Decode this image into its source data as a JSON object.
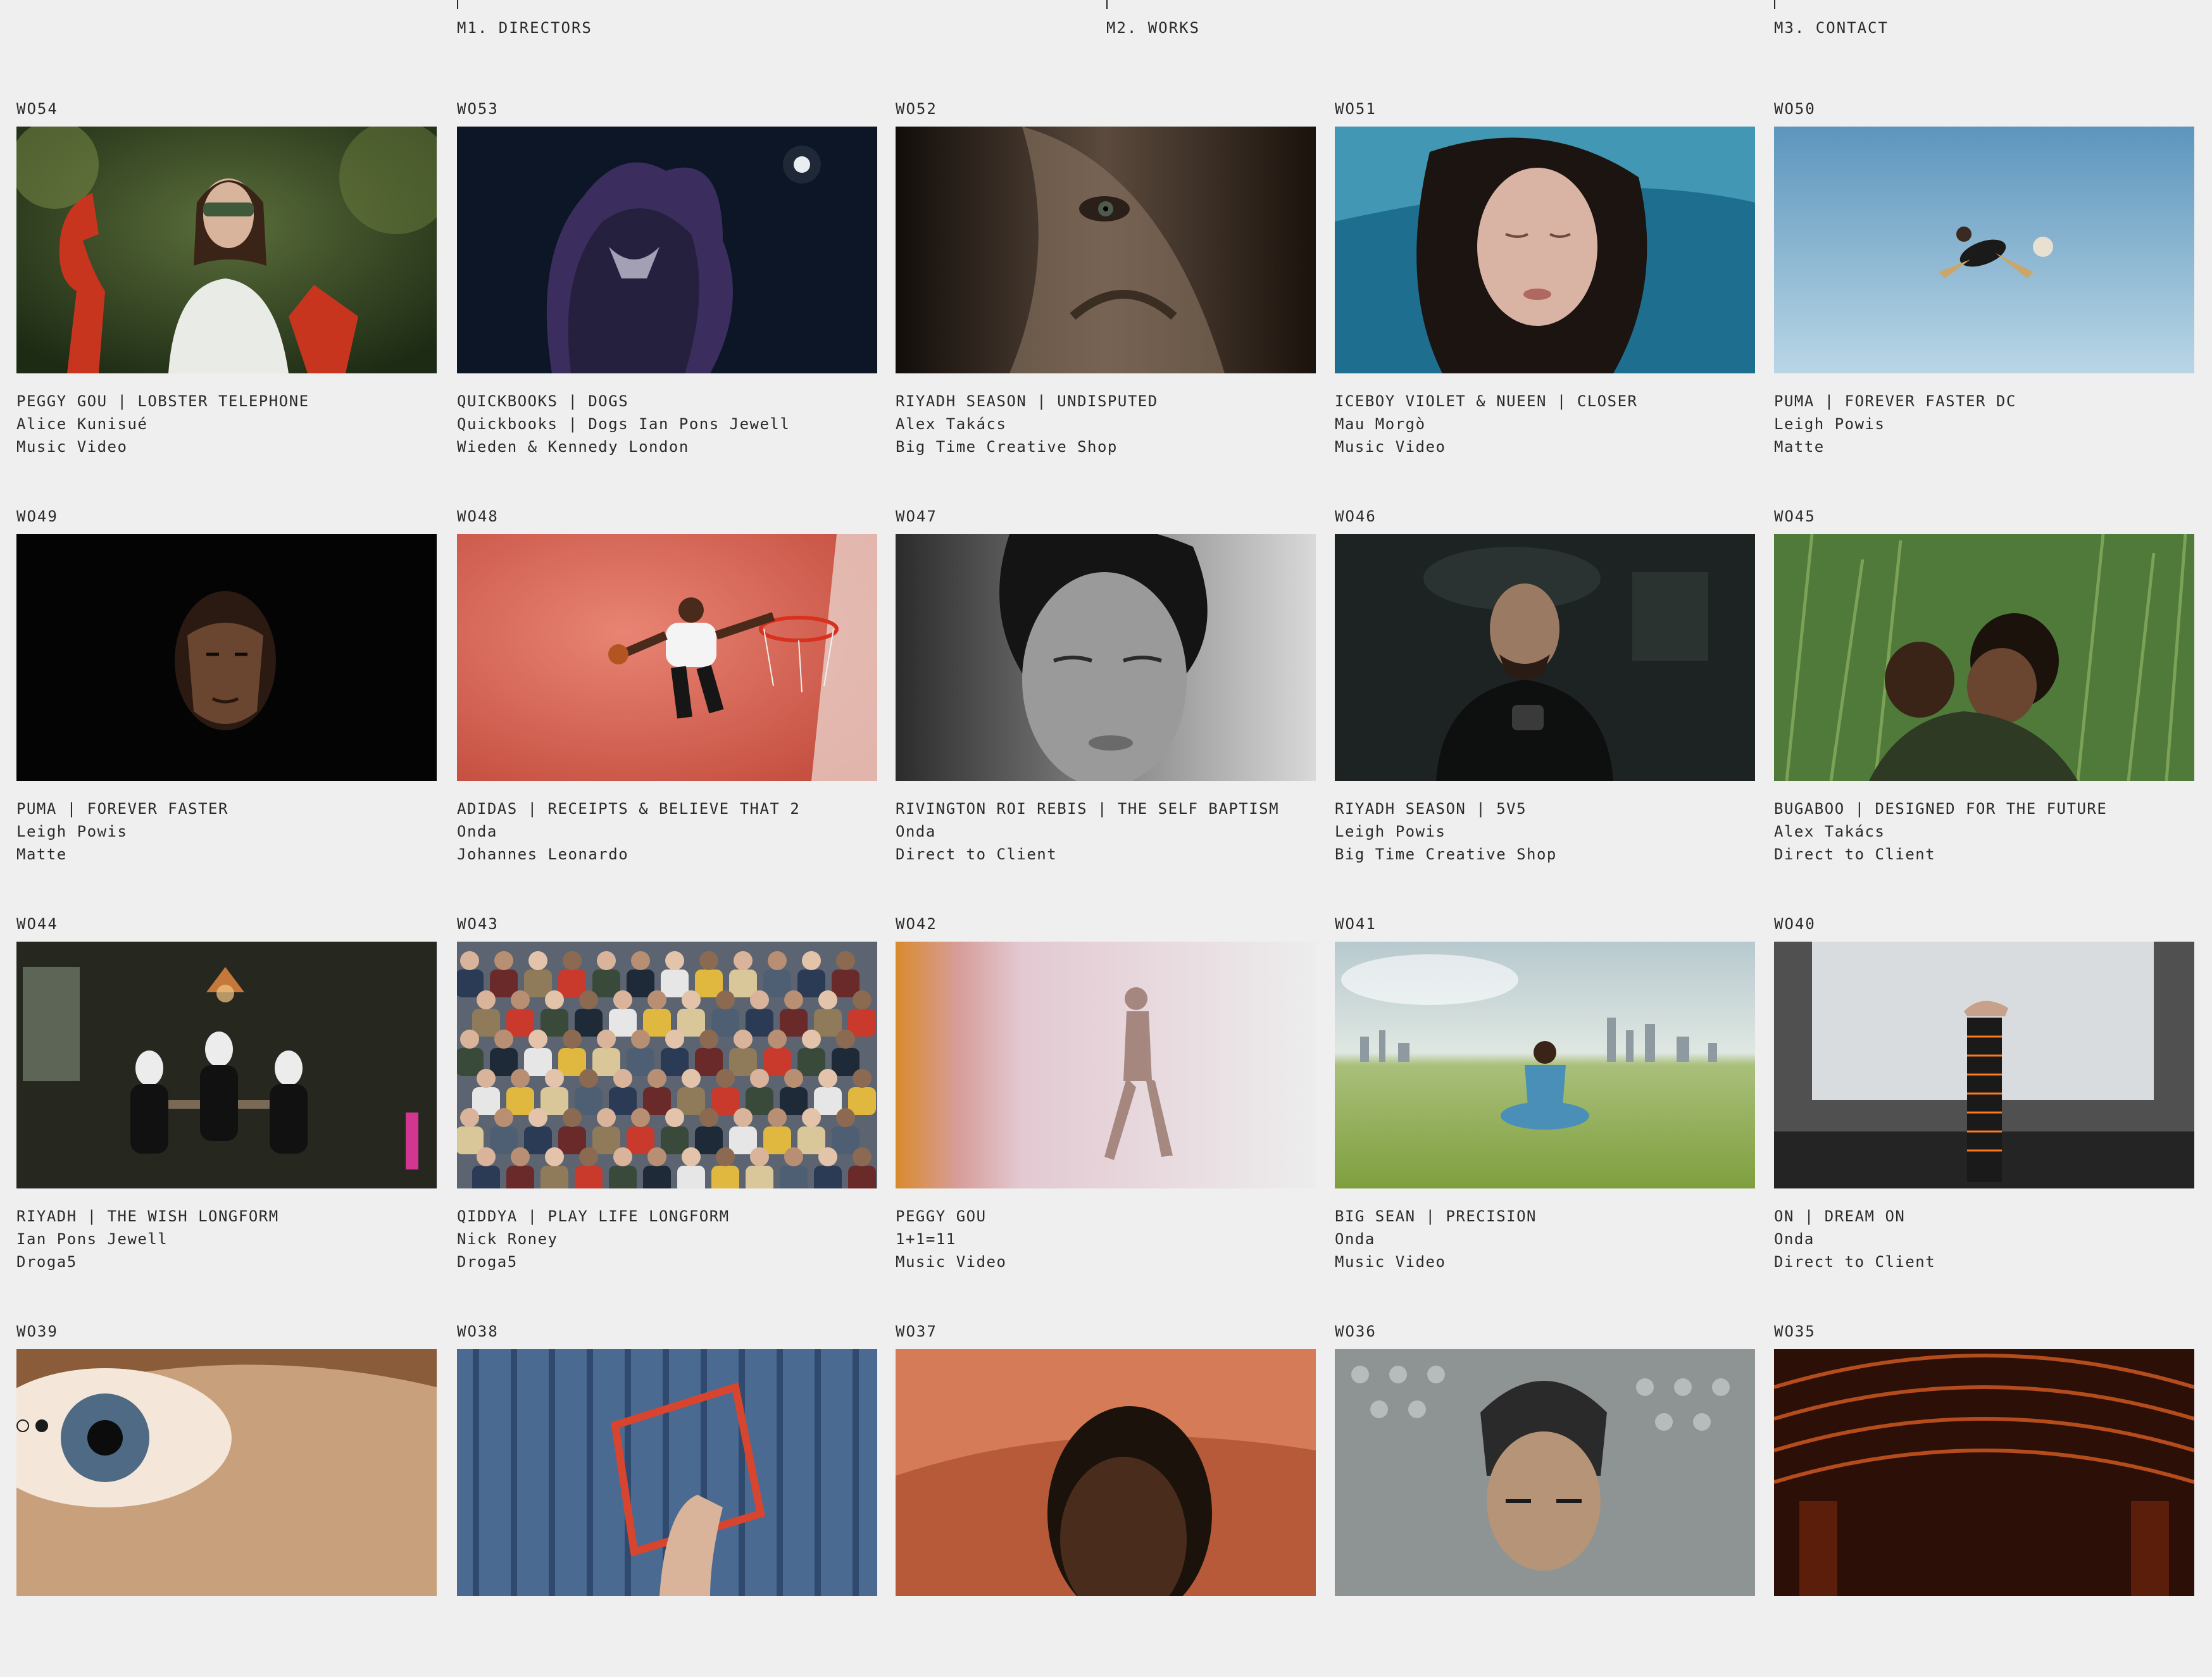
{
  "nav": [
    {
      "label": "M1. DIRECTORS"
    },
    {
      "label": "M2. WORKS"
    },
    {
      "label": "M3. CONTACT"
    }
  ],
  "works": [
    {
      "code": "WO54",
      "title": "PEGGY GOU | LOBSTER TELEPHONE",
      "director": "Alice Kunisué",
      "client": "Music Video",
      "scene": "woman-red-claw"
    },
    {
      "code": "WO53",
      "title": "QUICKBOOKS | DOGS",
      "director": "Quickbooks | Dogs Ian Pons Jewell",
      "client": "Wieden & Kennedy London",
      "scene": "night-creature"
    },
    {
      "code": "WO52",
      "title": "RIYADH SEASON | UNDISPUTED",
      "director": "Alex Takács",
      "client": "Big Time Creative Shop",
      "scene": "eye-closeup"
    },
    {
      "code": "WO51",
      "title": "ICEBOY VIOLET & NUEEN | CLOSER",
      "director": "Mau Morgò",
      "client": "Music Video",
      "scene": "sleeping-woman"
    },
    {
      "code": "WO50",
      "title": "PUMA | FOREVER FASTER DC",
      "director": "Leigh Powis",
      "client": "Matte",
      "scene": "sky-kick"
    },
    {
      "code": "WO49",
      "title": "PUMA | FOREVER FASTER",
      "director": "Leigh Powis",
      "client": "Matte",
      "scene": "dark-portrait"
    },
    {
      "code": "WO48",
      "title": "ADIDAS | RECEIPTS & BELIEVE THAT 2",
      "director": "Onda",
      "client": "Johannes Leonardo",
      "scene": "basketball-dunk"
    },
    {
      "code": "WO47",
      "title": "RIVINGTON ROI REBIS | THE SELF BAPTISM",
      "director": "Onda",
      "client": "Direct to Client",
      "scene": "bw-portrait"
    },
    {
      "code": "WO46",
      "title": "RIYADH SEASON | 5V5",
      "director": "Leigh Powis",
      "client": "Big Time Creative Shop",
      "scene": "man-with-gun"
    },
    {
      "code": "WO45",
      "title": "BUGABOO | DESIGNED FOR THE FUTURE",
      "director": "Alex Takács",
      "client": "Direct to Client",
      "scene": "grass-family"
    },
    {
      "code": "WO44",
      "title": "RIYADH | THE WISH LONGFORM",
      "director": "Ian Pons Jewell",
      "client": "Droga5",
      "scene": "masked-room"
    },
    {
      "code": "WO43",
      "title": "QIDDYA | PLAY LIFE LONGFORM",
      "director": "Nick Roney",
      "client": "Droga5",
      "scene": "crowd"
    },
    {
      "code": "WO42",
      "title": "PEGGY GOU",
      "director": "1+1=11",
      "client": "Music Video",
      "scene": "shadow-walk"
    },
    {
      "code": "WO41",
      "title": "BIG SEAN | PRECISION",
      "director": "Onda",
      "client": "Music Video",
      "scene": "meditation-field"
    },
    {
      "code": "WO40",
      "title": "ON | DREAM ON",
      "director": "Onda",
      "client": "Direct to Client",
      "scene": "shoe-pedestal"
    },
    {
      "code": "WO39",
      "title": "",
      "director": "",
      "client": "",
      "scene": "eye-macro"
    },
    {
      "code": "WO38",
      "title": "",
      "director": "",
      "client": "",
      "scene": "curtain-frame"
    },
    {
      "code": "WO37",
      "title": "",
      "director": "",
      "client": "",
      "scene": "orange-man"
    },
    {
      "code": "WO36",
      "title": "",
      "director": "",
      "client": "",
      "scene": "grey-man"
    },
    {
      "code": "WO35",
      "title": "",
      "director": "",
      "client": "",
      "scene": "copper-hall"
    }
  ],
  "colors": {
    "background": "#efefef",
    "text": "#2a2a2a"
  }
}
